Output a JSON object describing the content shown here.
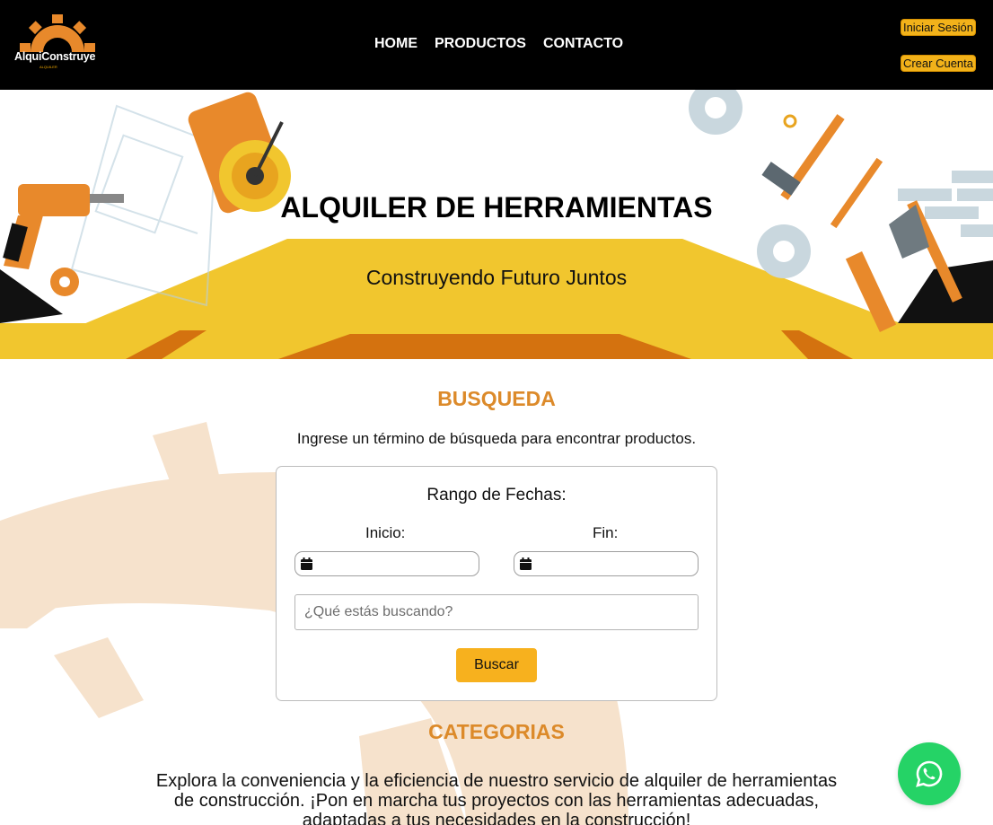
{
  "header": {
    "logo_text": "AlquiConstruye",
    "logo_tagline": "ALQUILER",
    "nav": [
      {
        "label": "HOME"
      },
      {
        "label": "PRODUCTOS"
      },
      {
        "label": "CONTACTO"
      }
    ],
    "login_label": "Iniciar Sesión",
    "register_label": "Crear Cuenta"
  },
  "hero": {
    "title": "ALQUILER DE HERRAMIENTAS",
    "subtitle": "Construyendo Futuro Juntos"
  },
  "search": {
    "title": "BUSQUEDA",
    "description": "Ingrese un término de búsqueda para encontrar productos.",
    "range_label": "Rango de Fechas:",
    "start_label": "Inicio:",
    "end_label": "Fin:",
    "placeholder": "¿Qué estás buscando?",
    "button_label": "Buscar"
  },
  "categories": {
    "title": "CATEGORIAS",
    "description": "Explora la conveniencia y la eficiencia de nuestro servicio de alquiler de herramientas de construcción. ¡Pon en marcha tus proyectos con las herramientas adecuadas, adaptadas a tus necesidades en la construcción!"
  },
  "icons": {
    "whatsapp": "whatsapp-icon",
    "calendar": "calendar-icon",
    "logo_gear": "gear-logo-icon"
  },
  "colors": {
    "accent": "#dc8a2a",
    "button": "#f7b11e",
    "header_bg": "#000000",
    "whatsapp": "#25d366"
  }
}
